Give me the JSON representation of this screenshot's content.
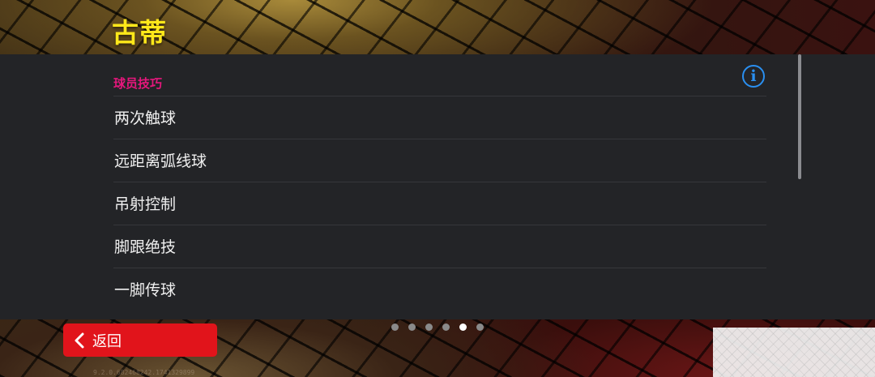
{
  "header": {
    "player_name": "古蒂"
  },
  "panel": {
    "section_title": "球员技巧",
    "info_icon": "info-icon",
    "skills": [
      {
        "label": "两次触球"
      },
      {
        "label": "远距离弧线球"
      },
      {
        "label": "吊射控制"
      },
      {
        "label": "脚跟绝技"
      },
      {
        "label": "一脚传球"
      }
    ]
  },
  "pager": {
    "page_count": 6,
    "active_page": 5
  },
  "footer": {
    "back_label": "返回",
    "back_icon": "chevron-left-icon",
    "version": "9.2.0.682468242.1741329899"
  },
  "colors": {
    "player_name": "#ffe81a",
    "section_title": "#e5177c",
    "info_icon": "#2a8ff0",
    "back_button": "#e1141b",
    "panel_bg": "#232427"
  }
}
